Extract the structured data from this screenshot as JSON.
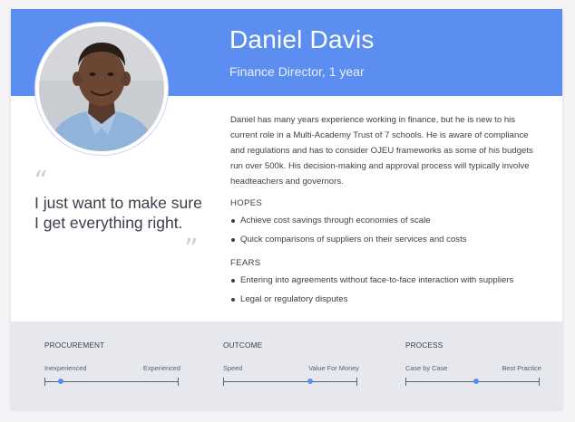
{
  "persona": {
    "name": "Daniel Davis",
    "role": "Finance Director, 1 year",
    "quote": "I just want to make sure I get everything right.",
    "bio": "Daniel has many years experience working in finance, but he is new  to his current role in a Multi-Academy Trust of 7 schools. He is aware of compliance and regulations and has to consider OJEU frameworks as some of his budgets run over 500k. His decision-making and approval process will typically involve headteachers and governors."
  },
  "hopes": {
    "title": "HOPES",
    "items": [
      "Achieve cost savings through economies of scale",
      "Quick comparisons of suppliers on their services and costs"
    ]
  },
  "fears": {
    "title": "FEARS",
    "items": [
      "Entering into agreements without face-to-face interaction with suppliers",
      "Legal or regulatory disputes"
    ]
  },
  "scales": [
    {
      "title": "PROCUREMENT",
      "low": "Inexperienced",
      "high": "Experienced",
      "value": 0.12
    },
    {
      "title": "OUTCOME",
      "low": "Speed",
      "high": "Value For Money",
      "value": 0.65
    },
    {
      "title": "PROCESS",
      "low": "Case by Case",
      "high": "Best Practice",
      "value": 0.53
    }
  ],
  "colors": {
    "accent": "#5b8ef0",
    "text": "#3a3f4b",
    "footer_bg": "#e6e8ee"
  },
  "icons": {
    "open_quote": "left-double-quote-icon",
    "close_quote": "right-double-quote-icon"
  }
}
